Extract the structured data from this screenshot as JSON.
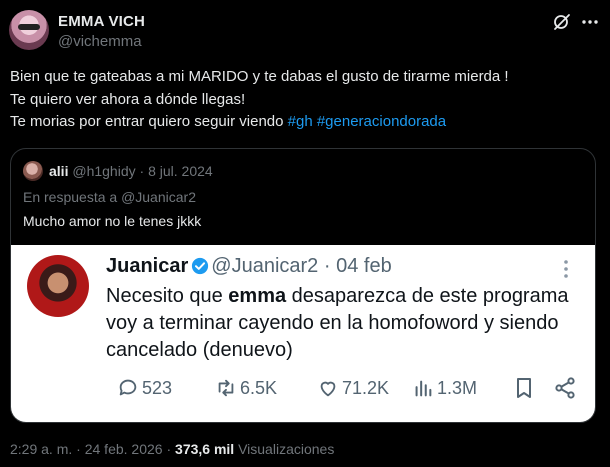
{
  "author": {
    "name": "EMMA VICH",
    "handle": "@vichemma"
  },
  "tweet": {
    "line1": "Bien que te gateabas a mi MARIDO y te dabas el gusto de tirarme mierda !",
    "line2": "Te quiero ver ahora  a dónde llegas!",
    "line3_text": "Te morias por entrar quiero seguir viendo ",
    "hashtag1": "#gh",
    "hashtag2": "#generaciondorada"
  },
  "quote": {
    "name": "alii",
    "handle": "@h1ghidy",
    "date": "8 jul. 2024",
    "reply_prefix": "En respuesta a ",
    "reply_to": "@Juanicar2",
    "text": "Mucho amor no le tenes jkkk"
  },
  "screenshot": {
    "name": "Juanicar",
    "handle": "@Juanicar2",
    "date": "04 feb",
    "line1_a": "Necesito que ",
    "line1_bold": "emma",
    "line1_b": " desaparezca de este programa",
    "line2": "voy a terminar cayendo en la homofoword y siendo",
    "line3": "cancelado (denuevo)",
    "replies": "523",
    "reposts": "6.5K",
    "likes": "71.2K",
    "views": "1.3M"
  },
  "meta": {
    "time": "2:29 a. m.",
    "date": "24 feb. 2026",
    "views_count": "373,6 mil",
    "views_label": "Visualizaciones"
  },
  "colors": {
    "link": "#1d9bf0",
    "muted": "#71767b",
    "verified": "#1d9bf0"
  }
}
